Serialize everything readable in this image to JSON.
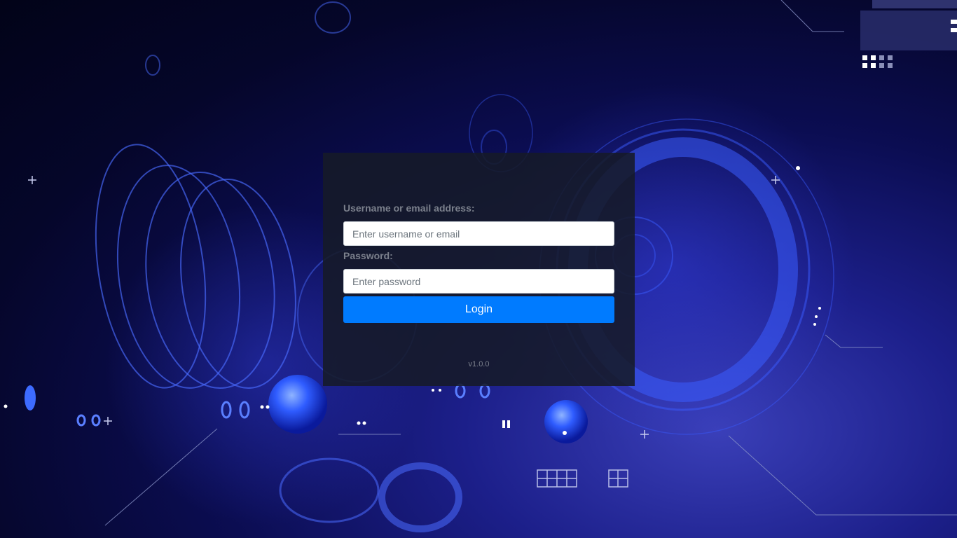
{
  "login": {
    "username_label": "Username or email address:",
    "username_placeholder": "Enter username or email",
    "password_label": "Password:",
    "password_placeholder": "Enter password",
    "button_label": "Login",
    "version": "v1.0.0"
  }
}
